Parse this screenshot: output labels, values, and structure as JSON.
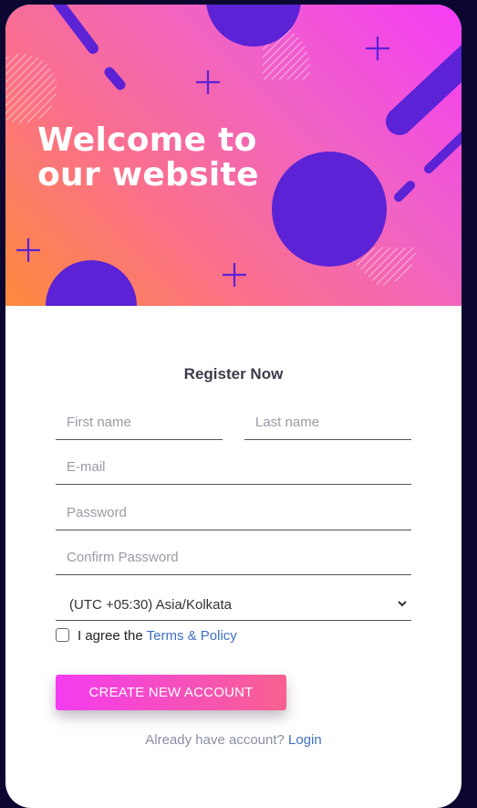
{
  "hero": {
    "title_line1": "Welcome to",
    "title_line2": "our website"
  },
  "form": {
    "title": "Register Now",
    "first_name_placeholder": "First name",
    "last_name_placeholder": "Last name",
    "email_placeholder": "E-mail",
    "password_placeholder": "Password",
    "confirm_password_placeholder": "Confirm Password",
    "timezone_value": "(UTC +05:30) Asia/Kolkata",
    "agree_text": "I agree the",
    "terms_link": "Terms & Policy",
    "submit_label": "CREATE NEW ACCOUNT",
    "have_account_text": "Already have account?",
    "login_link": "Login"
  },
  "colors": {
    "page_background": "#0b0730",
    "hero_gradient": [
      "#f43cf6",
      "#ff8a3c"
    ],
    "shape_purple": "#5b22d6",
    "button_gradient": [
      "#f43bf0",
      "#f86190"
    ],
    "link": "#3d6fc2"
  },
  "icons": {
    "select_caret": "chevron-down-icon",
    "plus": "plus-icon"
  }
}
